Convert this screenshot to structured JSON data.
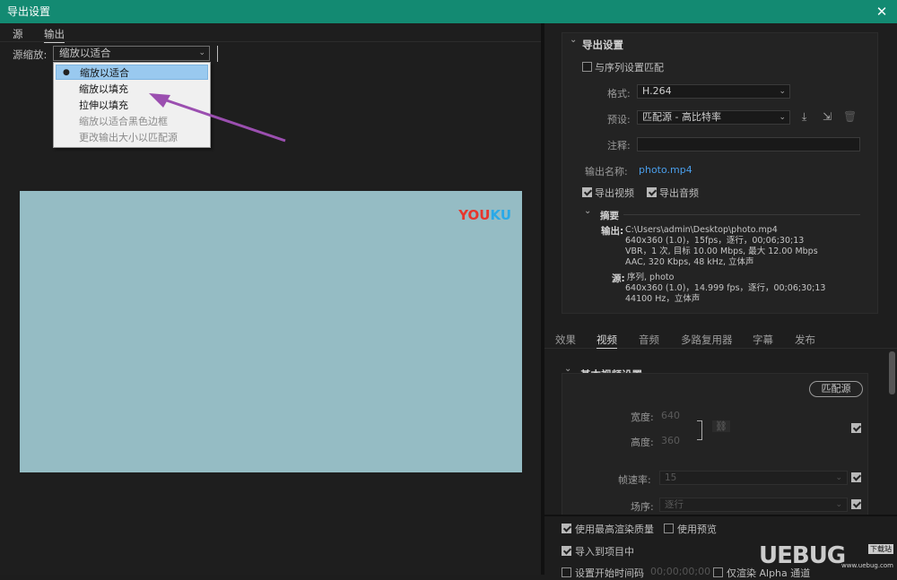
{
  "window": {
    "title": "导出设置",
    "close_glyph": "✕"
  },
  "left": {
    "tabs": [
      "源",
      "输出"
    ],
    "source_scale_label": "源缩放:",
    "source_scale_value": "缩放以适合",
    "dropdown_items": [
      {
        "label": "缩放以适合",
        "selected": true,
        "enabled": true
      },
      {
        "label": "缩放以填充",
        "selected": false,
        "enabled": true
      },
      {
        "label": "拉伸以填充",
        "selected": false,
        "enabled": true
      },
      {
        "label": "缩放以适合黑色边框",
        "selected": false,
        "enabled": false
      },
      {
        "label": "更改输出大小以匹配源",
        "selected": false,
        "enabled": false
      }
    ],
    "preview_logo": {
      "part1": "YOU",
      "part2": "KU"
    }
  },
  "export_settings": {
    "title": "导出设置",
    "match_sequence_label": "与序列设置匹配",
    "format_label": "格式:",
    "format_value": "H.264",
    "preset_label": "预设:",
    "preset_value": "匹配源 - 高比特率",
    "comment_label": "注释:",
    "output_name_label": "输出名称:",
    "output_name_value": "photo.mp4",
    "export_video_label": "导出视频",
    "export_audio_label": "导出音频",
    "summary_title": "摘要",
    "summary_output_label": "输出:",
    "summary_output_lines": [
      "C:\\Users\\admin\\Desktop\\photo.mp4",
      "640x360 (1.0)，15fps，逐行，00;06;30;13",
      "VBR，1 次, 目标 10.00 Mbps, 最大 12.00 Mbps",
      "AAC, 320 Kbps, 48  kHz, 立体声"
    ],
    "summary_source_label": "源:",
    "summary_source_lines": [
      "序列, photo",
      "640x360 (1.0)，14.999 fps，逐行，00;06;30;13",
      "44100 Hz，立体声"
    ]
  },
  "settings_tabs": [
    "效果",
    "视频",
    "音频",
    "多路复用器",
    "字幕",
    "发布"
  ],
  "basic_video": {
    "title": "基本视频设置",
    "match_source_button": "匹配源",
    "width_label": "宽度:",
    "width_value": "640",
    "height_label": "高度:",
    "height_value": "360",
    "framerate_label": "帧速率:",
    "framerate_value": "15",
    "field_order_label": "场序:",
    "field_order_value": "逐行"
  },
  "bottom": {
    "max_render_quality": "使用最高渲染质量",
    "use_previews": "使用预览",
    "import_into_project": "导入到项目中",
    "set_start_timecode": "设置开始时间码",
    "start_timecode_value": "00;00;00;00",
    "render_alpha_only": "仅渲染 Alpha 通道"
  },
  "watermark": {
    "text": "UEBUG",
    "subtext": "下载站",
    "url": "www.uebug.com"
  },
  "colors": {
    "titlebar": "#138a72",
    "accent_blue": "#4a9eea",
    "selected_item": "#99c9ef",
    "preview_bg": "#95bcc4"
  }
}
